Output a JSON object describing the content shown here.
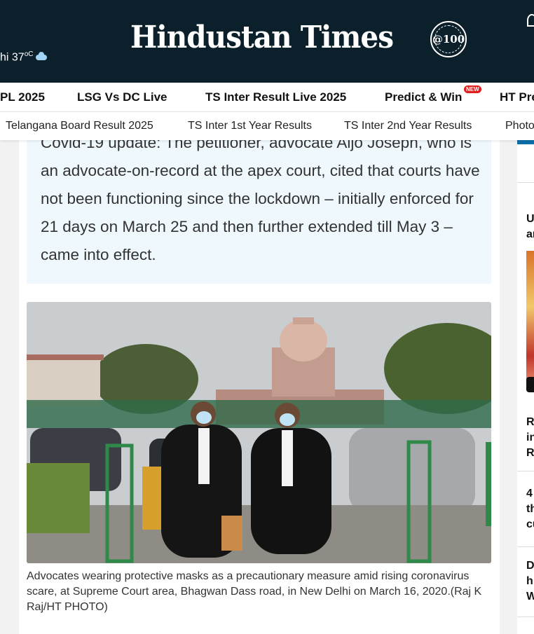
{
  "header": {
    "weather_text": "hi 37",
    "weather_unit": "oC",
    "logo": "Hindustan Times",
    "seal": "@100"
  },
  "nav_primary": [
    "PL 2025",
    "LSG Vs DC Live",
    "TS Inter Result Live 2025",
    "Predict & Win",
    "HT Pre"
  ],
  "new_badge": "NEW",
  "nav_secondary": [
    "Telangana Board Result 2025",
    "TS Inter 1st Year Results",
    "TS Inter 2nd Year Results",
    "Photo"
  ],
  "highlight": {
    "text": "Covid-19 update: The petitioner, advocate Aljo Joseph, who is an advocate-on-record at the apex court, cited that courts have not been functioning since the lockdown – initially enforced for 21 days on March 25 and then further extended till May 3 – came into effect."
  },
  "photo": {
    "caption": "Advocates wearing protective masks as a precautionary measure amid rising coronavirus scare, at Supreme Court area, Bhagwan Dass road, in New Delhi on March 16, 2020.(Raj K Raj/HT PHOTO)"
  },
  "right_column": {
    "items": [
      "U",
      "ar",
      "R",
      "in",
      "R",
      "4",
      "th",
      "cu",
      "D",
      "h",
      "W"
    ]
  },
  "colors": {
    "header_bg": "#0b202b",
    "highlight_bg": "#eef8fd",
    "badge": "#e01e1e"
  }
}
